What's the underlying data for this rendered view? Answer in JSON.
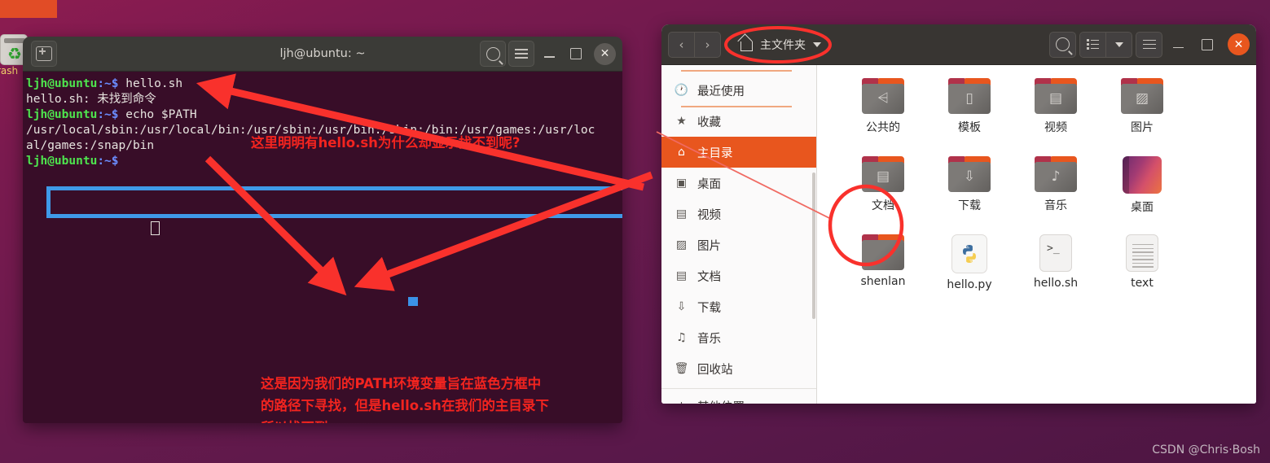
{
  "desktop": {
    "dock": {
      "trash_label": "rash",
      "trash_icon": "trash-recycle-icon"
    },
    "watermark": "CSDN @Chris·Bosh"
  },
  "terminal": {
    "title": "ljh@ubuntu: ~",
    "titlebar_icons": [
      "new-tab-icon",
      "search-icon",
      "hamburger-menu-icon",
      "minimize-icon",
      "maximize-icon",
      "close-icon"
    ],
    "close_label": "✕",
    "lines": [
      {
        "prompt": "ljh@ubuntu",
        "path": ":~$",
        "cmd": " hello.sh"
      },
      {
        "plain": "hello.sh: 未找到命令"
      },
      {
        "prompt": "ljh@ubuntu",
        "path": ":~$",
        "cmd": " echo $PATH"
      }
    ],
    "path_output_line1": "/usr/local/sbin:/usr/local/bin:/usr/sbin:/usr/bin:/sbin:/bin:/usr/games:/usr/loc",
    "path_output_line2": "al/games:/snap/bin",
    "last_prompt": {
      "prompt": "ljh@ubuntu",
      "path": ":~$"
    },
    "annotations": {
      "top": "这里明明有hello.sh为什么却显示找不到呢?",
      "bottom_line1": "这是因为我们的PATH环境变量旨在蓝色方框中",
      "bottom_line2": "的路径下寻找，但是hello.sh在我们的主目录下",
      "bottom_line3": "所以找不到"
    },
    "highlight_color": "#3f9ae8",
    "annotation_color": "#f3241f",
    "background_color": "#380d28"
  },
  "filemanager": {
    "header": {
      "back_icon": "chevron-left-icon",
      "forward_icon": "chevron-right-icon",
      "location_label": "主文件夹",
      "location_icon": "home-icon",
      "location_caret": "chevron-down-icon",
      "search_icon": "search-icon",
      "view_list_icon": "list-view-icon",
      "view_caret_icon": "chevron-down-icon",
      "menu_icon": "hamburger-menu-icon",
      "minimize_icon": "minimize-icon",
      "maximize_icon": "maximize-icon",
      "close_label": "✕",
      "accent_color": "#e8561e"
    },
    "sidebar": [
      {
        "label": "最近使用",
        "icon": "clock-icon",
        "active": false
      },
      {
        "label": "收藏",
        "icon": "star-icon",
        "active": false
      },
      {
        "label": "主目录",
        "icon": "home-icon",
        "active": true
      },
      {
        "label": "桌面",
        "icon": "desktop-icon",
        "active": false
      },
      {
        "label": "视频",
        "icon": "film-icon",
        "active": false
      },
      {
        "label": "图片",
        "icon": "image-icon",
        "active": false
      },
      {
        "label": "文档",
        "icon": "document-icon",
        "active": false
      },
      {
        "label": "下载",
        "icon": "download-icon",
        "active": false
      },
      {
        "label": "音乐",
        "icon": "music-icon",
        "active": false
      },
      {
        "label": "回收站",
        "icon": "trash-icon",
        "active": false
      },
      {
        "label": "其他位置",
        "icon": "plus-icon",
        "active": false
      }
    ],
    "files": [
      {
        "name": "公共的",
        "type": "folder",
        "glyph": "⋖"
      },
      {
        "name": "模板",
        "type": "folder",
        "glyph": "▯"
      },
      {
        "name": "视频",
        "type": "folder",
        "glyph": "▤"
      },
      {
        "name": "图片",
        "type": "folder",
        "glyph": "▣"
      },
      {
        "name": "文档",
        "type": "folder",
        "glyph": "▤"
      },
      {
        "name": "下载",
        "type": "folder",
        "glyph": "⇓"
      },
      {
        "name": "音乐",
        "type": "folder",
        "glyph": "♪"
      },
      {
        "name": "桌面",
        "type": "desktop",
        "glyph": ""
      },
      {
        "name": "shenlan",
        "type": "folder-plain",
        "glyph": ""
      },
      {
        "name": "hello.py",
        "type": "python",
        "glyph": ""
      },
      {
        "name": "hello.sh",
        "type": "script",
        "glyph": ">_"
      },
      {
        "name": "text",
        "type": "textfile",
        "glyph": ""
      }
    ]
  }
}
